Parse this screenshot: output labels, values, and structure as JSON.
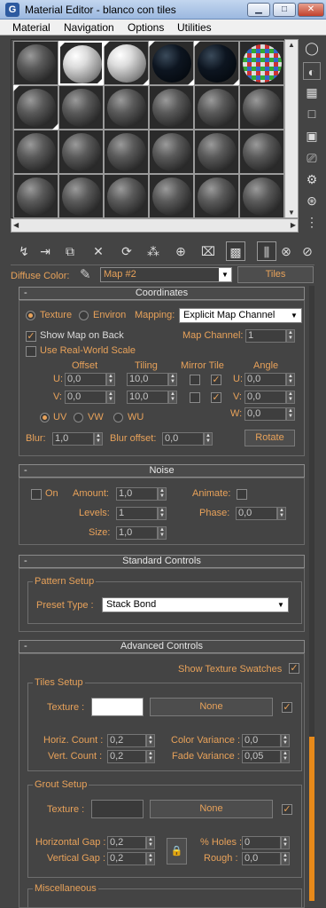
{
  "window": {
    "title": "Material Editor - blanco con tiles",
    "app_icon": "3ds-max-icon"
  },
  "window_controls": {
    "minimize": "▁",
    "maximize": "□",
    "close": "✕"
  },
  "menu": [
    "Material",
    "Navigation",
    "Options",
    "Utilities"
  ],
  "sample_slots": [
    "gray",
    "white",
    "white",
    "dark",
    "dark",
    "checker",
    "gray",
    "gray",
    "gray",
    "gray",
    "gray",
    "gray",
    "gray",
    "gray",
    "gray",
    "gray",
    "gray",
    "gray",
    "gray",
    "gray",
    "gray",
    "gray",
    "gray",
    "gray"
  ],
  "side_icons": [
    "sample-type-icon",
    "backlight-icon",
    "background-icon",
    "sample-uv-tiling-icon",
    "video-color-check-icon",
    "make-preview-icon",
    "options-icon",
    "select-by-material-icon",
    "material-map-navigator-icon"
  ],
  "bottom_icons": [
    "get-material-icon",
    "put-to-scene-icon",
    "assign-to-selection-icon",
    "reset-map-icon",
    "copy-material-icon",
    "make-unique-icon",
    "put-to-library-icon",
    "material-id-channel-icon",
    "show-map-in-viewport-icon",
    "show-end-result-icon",
    "go-to-parent-icon",
    "go-forward-to-sibling-icon"
  ],
  "map_row": {
    "label": "Diffuse Color:",
    "map_name": "Map #2",
    "map_type": "Tiles"
  },
  "coordinates": {
    "header": "Coordinates",
    "texture_label": "Texture",
    "environ_label": "Environ",
    "mapping_label": "Mapping:",
    "mapping_value": "Explicit Map Channel",
    "show_map_on_back": "Show Map on Back",
    "use_real_world_scale": "Use Real-World Scale",
    "map_channel_label": "Map Channel:",
    "map_channel_value": "1",
    "offset_label": "Offset",
    "tiling_label": "Tiling",
    "mirror_tile_label": "Mirror Tile",
    "angle_label": "Angle",
    "u_label": "U:",
    "v_label": "V:",
    "w_label": "W:",
    "u_offset": "0,0",
    "v_offset": "0,0",
    "u_tiling": "10,0",
    "v_tiling": "10,0",
    "u_angle": "0,0",
    "v_angle": "0,0",
    "w_angle": "0,0",
    "uv_label": "UV",
    "vw_label": "VW",
    "wu_label": "WU",
    "blur_label": "Blur:",
    "blur_value": "1,0",
    "blur_offset_label": "Blur offset:",
    "blur_offset_value": "0,0",
    "rotate_label": "Rotate"
  },
  "noise": {
    "header": "Noise",
    "on_label": "On",
    "amount_label": "Amount:",
    "amount_value": "1,0",
    "levels_label": "Levels:",
    "levels_value": "1",
    "size_label": "Size:",
    "size_value": "1,0",
    "animate_label": "Animate:",
    "phase_label": "Phase:",
    "phase_value": "0,0"
  },
  "standard_controls": {
    "header": "Standard Controls",
    "pattern_setup": "Pattern Setup",
    "preset_type_label": "Preset Type :",
    "preset_type_value": "Stack Bond"
  },
  "advanced_controls": {
    "header": "Advanced Controls",
    "show_texture_swatches": "Show Texture Swatches",
    "tiles_setup": "Tiles Setup",
    "tiles_texture_label": "Texture :",
    "tiles_map": "None",
    "horiz_count_label": "Horiz. Count :",
    "horiz_count_value": "0,2",
    "vert_count_label": "Vert. Count :",
    "vert_count_value": "0,2",
    "color_variance_label": "Color Variance :",
    "color_variance_value": "0,0",
    "fade_variance_label": "Fade Variance :",
    "fade_variance_value": "0,05",
    "grout_setup": "Grout Setup",
    "grout_texture_label": "Texture :",
    "grout_map": "None",
    "horizontal_gap_label": "Horizontal Gap :",
    "horizontal_gap_value": "0,2",
    "vertical_gap_label": "Vertical Gap :",
    "vertical_gap_value": "0,2",
    "holes_label": "% Holes :",
    "holes_value": "0",
    "rough_label": "Rough :",
    "rough_value": "0,0",
    "miscellaneous": "Miscellaneous"
  },
  "colors": {
    "accent": "#e8a25a",
    "panel": "#444444",
    "tile_color": "#ffffff",
    "grout_color": "#3a3a3a",
    "scroll_thumb": "#e88a1a"
  }
}
